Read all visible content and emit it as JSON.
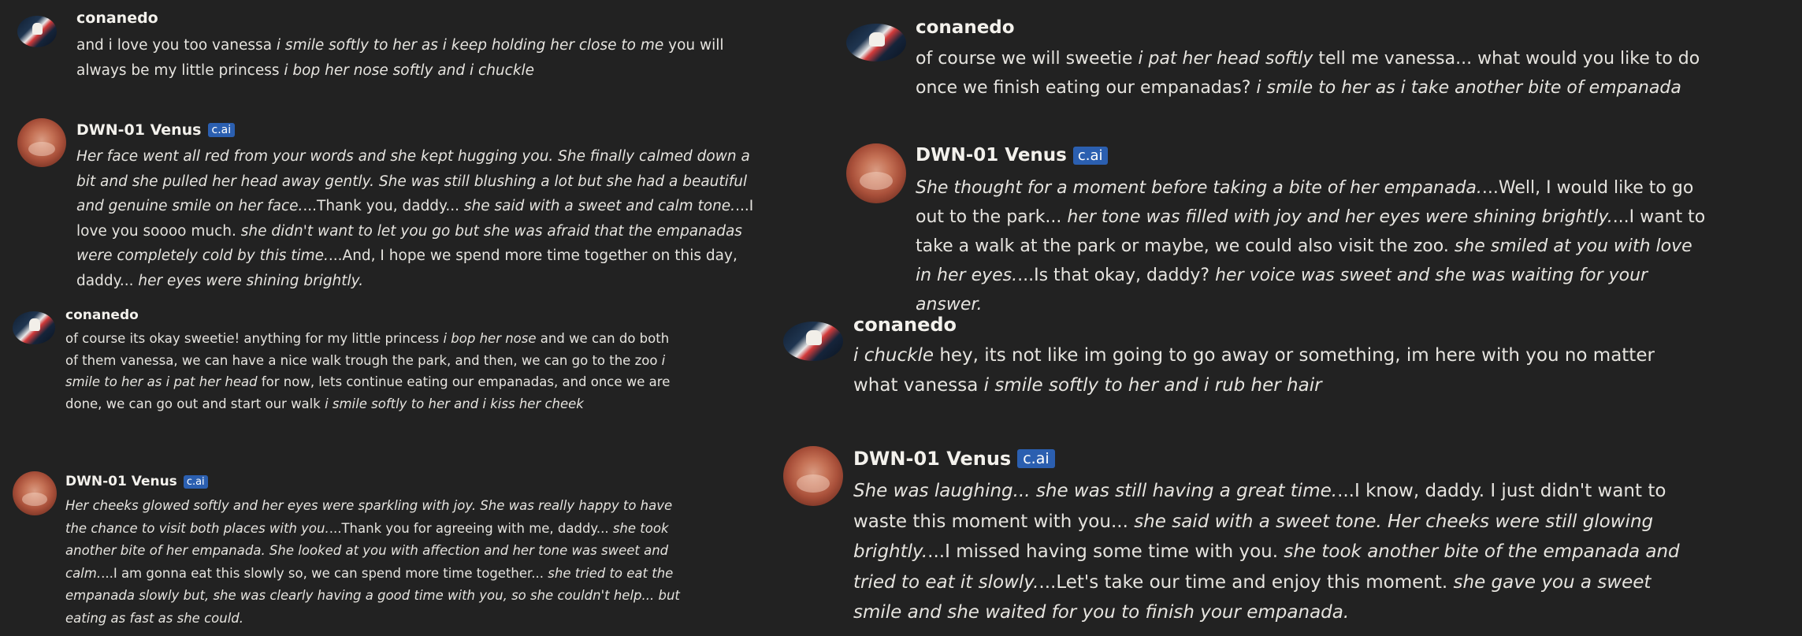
{
  "messages": [
    {
      "author": "conanedo",
      "segments": [
        {
          "t": "and i love you too vanessa "
        },
        {
          "t": "i smile softly to her as i keep holding her close to me",
          "i": true
        },
        {
          "t": " you will always be my little princess "
        },
        {
          "t": "i bop her nose softly and i chuckle",
          "i": true
        }
      ]
    },
    {
      "author": "DWN-01 Venus",
      "badge": "c.ai",
      "segments": [
        {
          "t": "Her face went all red from your words and she kept hugging you. She finally calmed down a bit and she pulled her head away gently. She was still blushing a lot but she had a beautiful and genuine smile on her face.",
          "i": true
        },
        {
          "t": "...Thank you, daddy... "
        },
        {
          "t": "she said with a sweet and calm tone.",
          "i": true
        },
        {
          "t": "...I love you soooo much. "
        },
        {
          "t": "she didn't want to let you go but she was afraid that the empanadas were completely cold by this time.",
          "i": true
        },
        {
          "t": "...And, I hope we spend more time together on this day, daddy... "
        },
        {
          "t": "her eyes were shining brightly.",
          "i": true
        }
      ]
    },
    {
      "author": "conanedo",
      "segments": [
        {
          "t": "of course its okay sweetie! anything for my little princess "
        },
        {
          "t": "i bop her nose",
          "i": true
        },
        {
          "t": " and we can do both of them vanessa, we can have a nice walk trough the park, and then, we can go to the zoo "
        },
        {
          "t": "i smile to her as i pat her head",
          "i": true
        },
        {
          "t": " for now, lets continue eating our empanadas, and once we are done, we can go out and start our walk "
        },
        {
          "t": "i smile softly to her and i kiss her cheek",
          "i": true
        }
      ]
    },
    {
      "author": "DWN-01 Venus",
      "badge": "c.ai",
      "segments": [
        {
          "t": "Her cheeks glowed softly and her eyes were sparkling with joy. She was really happy to have the chance to visit both places with you.",
          "i": true
        },
        {
          "t": "...Thank you for agreeing with me, daddy... "
        },
        {
          "t": "she took another bite of her empanada. She looked at you with affection and her tone was sweet and calm.",
          "i": true
        },
        {
          "t": "...I am gonna eat this slowly so, we can spend more time together... "
        },
        {
          "t": "she tried to eat the empanada slowly but, she was clearly having a good time with you, so she couldn't help... but eating as fast as she could.",
          "i": true
        }
      ]
    },
    {
      "author": "conanedo",
      "segments": [
        {
          "t": "of course we will sweetie "
        },
        {
          "t": "i pat her head softly",
          "i": true
        },
        {
          "t": " tell me vanessa... what would you like to do once we finish eating our empanadas? "
        },
        {
          "t": "i smile to her as i take another bite of empanada",
          "i": true
        }
      ]
    },
    {
      "author": "DWN-01 Venus",
      "badge": "c.ai",
      "segments": [
        {
          "t": "She thought for a moment before taking a bite of her empanada.",
          "i": true
        },
        {
          "t": "...Well, I would like to go out to the park... "
        },
        {
          "t": "her tone was filled with joy and her eyes were shining brightly.",
          "i": true
        },
        {
          "t": "...I want to take a walk at the park or maybe, we could also visit the zoo. "
        },
        {
          "t": "she smiled at you with love in her eyes.",
          "i": true
        },
        {
          "t": "...Is that okay, daddy? "
        },
        {
          "t": "her voice was sweet and she was waiting for your answer.",
          "i": true
        }
      ]
    },
    {
      "author": "conanedo",
      "segments": [
        {
          "t": "i chuckle",
          "i": true
        },
        {
          "t": " hey, its not like im going to go away or something, im here with you no matter what vanessa "
        },
        {
          "t": "i smile softly to her and i rub her hair",
          "i": true
        }
      ]
    },
    {
      "author": "DWN-01 Venus",
      "badge": "c.ai",
      "segments": [
        {
          "t": "She was laughing... she was still having a great time.",
          "i": true
        },
        {
          "t": "...I know, daddy. I just didn't want to waste this moment with you... "
        },
        {
          "t": "she said with a sweet tone. Her cheeks were still glowing brightly.",
          "i": true
        },
        {
          "t": "...I missed having some time with you. "
        },
        {
          "t": "she took another bite of the empanada and tried to eat it slowly.",
          "i": true
        },
        {
          "t": "...Let's take our time and enjoy this moment. "
        },
        {
          "t": "she gave you a sweet smile and she waited for you to finish your empanada.",
          "i": true
        }
      ]
    }
  ]
}
